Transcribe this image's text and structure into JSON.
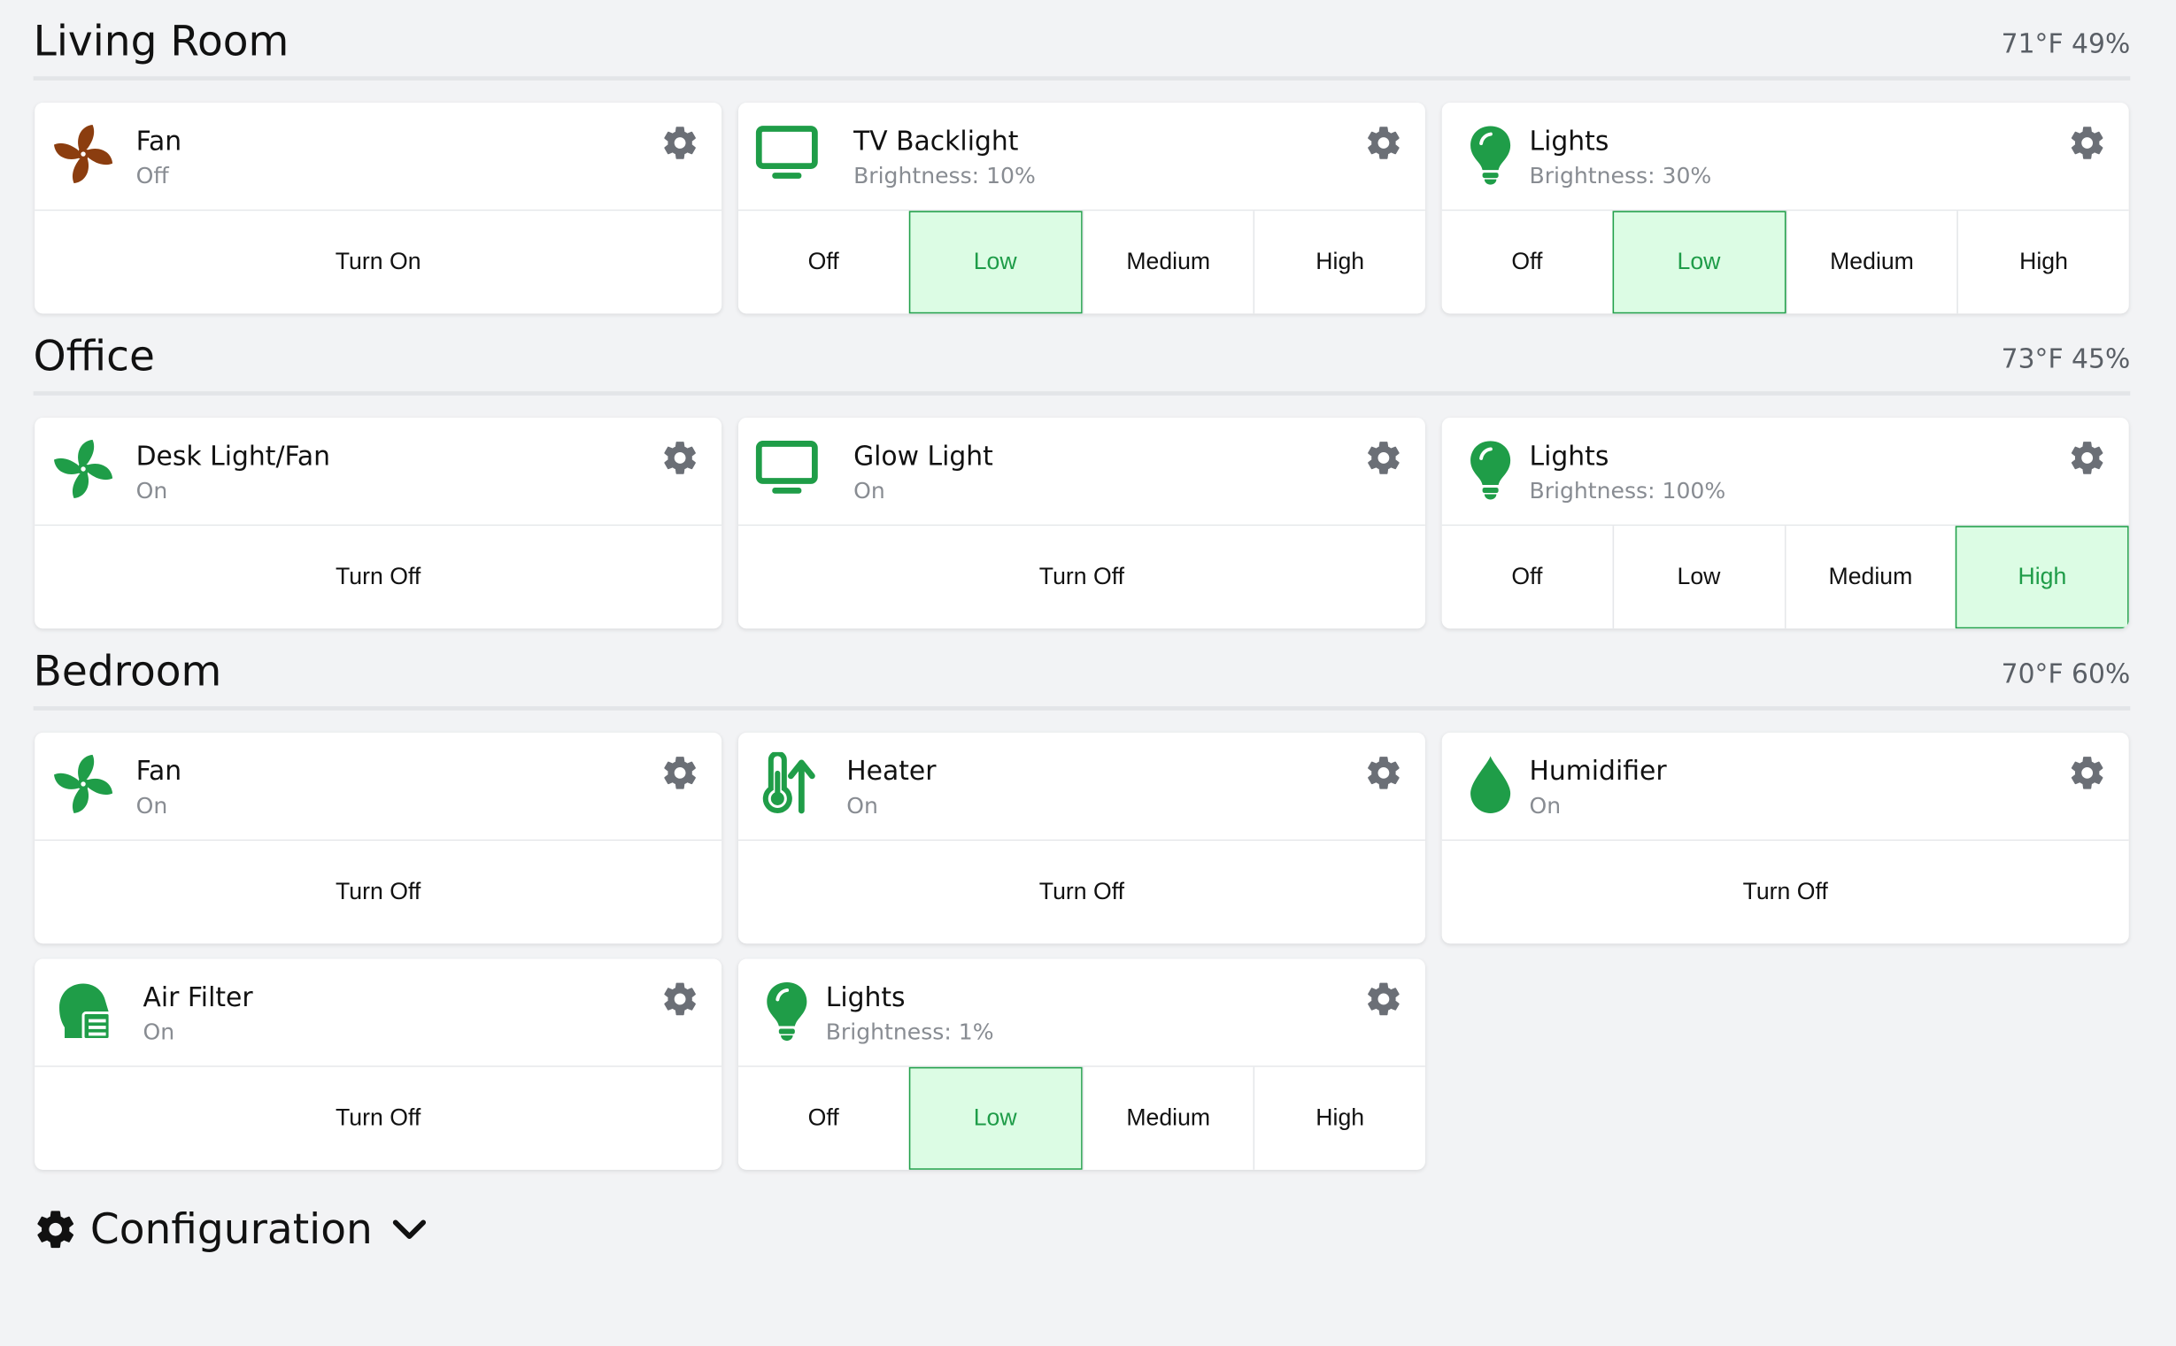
{
  "colors": {
    "background": "#f2f3f5",
    "card": "#ffffff",
    "on_green": "#1f9d48",
    "off_brown": "#8b3d0f",
    "active_fill": "#dcfce4",
    "active_text": "#1e9c48",
    "gear": "#6b6f76"
  },
  "rooms": [
    {
      "name": "Living Room",
      "env": "71°F 49%",
      "devices": [
        {
          "name": "Fan",
          "status": "Off",
          "icon": "fan-icon",
          "state": "off",
          "actions": [
            "Turn On"
          ],
          "active": -1
        },
        {
          "name": "TV Backlight",
          "status": "Brightness: 10%",
          "icon": "monitor-icon",
          "state": "on",
          "actions": [
            "Off",
            "Low",
            "Medium",
            "High"
          ],
          "active": 1
        },
        {
          "name": "Lights",
          "status": "Brightness: 30%",
          "icon": "lightbulb-icon",
          "state": "on",
          "actions": [
            "Off",
            "Low",
            "Medium",
            "High"
          ],
          "active": 1
        }
      ]
    },
    {
      "name": "Office",
      "env": "73°F 45%",
      "devices": [
        {
          "name": "Desk Light/Fan",
          "status": "On",
          "icon": "fan-icon",
          "state": "on",
          "actions": [
            "Turn Off"
          ],
          "active": -1
        },
        {
          "name": "Glow Light",
          "status": "On",
          "icon": "monitor-icon",
          "state": "on",
          "actions": [
            "Turn Off"
          ],
          "active": -1
        },
        {
          "name": "Lights",
          "status": "Brightness: 100%",
          "icon": "lightbulb-icon",
          "state": "on",
          "actions": [
            "Off",
            "Low",
            "Medium",
            "High"
          ],
          "active": 3
        }
      ]
    },
    {
      "name": "Bedroom",
      "env": "70°F 60%",
      "devices": [
        {
          "name": "Fan",
          "status": "On",
          "icon": "fan-icon",
          "state": "on",
          "actions": [
            "Turn Off"
          ],
          "active": -1
        },
        {
          "name": "Heater",
          "status": "On",
          "icon": "thermometer-up-icon",
          "state": "on",
          "actions": [
            "Turn Off"
          ],
          "active": -1
        },
        {
          "name": "Humidifier",
          "status": "On",
          "icon": "droplet-icon",
          "state": "on",
          "actions": [
            "Turn Off"
          ],
          "active": -1
        },
        {
          "name": "Air Filter",
          "status": "On",
          "icon": "air-filter-icon",
          "state": "on",
          "actions": [
            "Turn Off"
          ],
          "active": -1
        },
        {
          "name": "Lights",
          "status": "Brightness: 1%",
          "icon": "lightbulb-icon",
          "state": "on",
          "actions": [
            "Off",
            "Low",
            "Medium",
            "High"
          ],
          "active": 1
        }
      ]
    }
  ],
  "configuration": {
    "label": "Configuration",
    "icon": "gear-icon",
    "toggle_icon": "chevron-down-icon"
  }
}
